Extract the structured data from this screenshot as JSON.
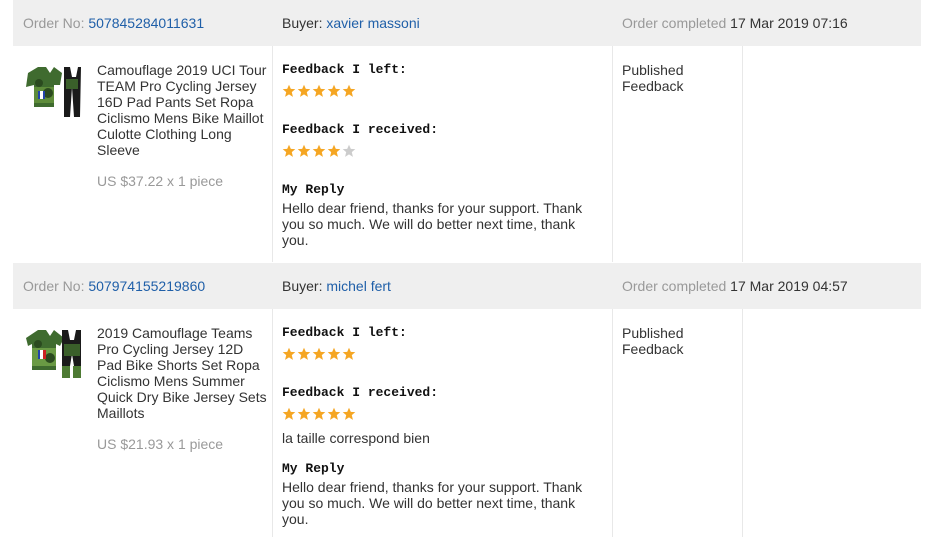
{
  "colors": {
    "header_bg": "#efefef",
    "link": "#1f5fa8",
    "star_on": "#f5a623",
    "star_off": "#cccccc",
    "muted": "#999999"
  },
  "orders": [
    {
      "order_no_label": "Order No:",
      "order_no": "507845284011631",
      "buyer_label": "Buyer:",
      "buyer": "xavier massoni",
      "completed_label": "Order completed",
      "completed_date": "17 Mar 2019 07:16",
      "product_title": "Camouflage 2019 UCI Tour TEAM Pro Cycling Jersey 16D Pad Pants Set Ropa Ciclismo Mens Bike Maillot Culotte Clothing Long Sleeve",
      "price": "US $37.22 x 1 piece",
      "product_image_icon": "cycling-kit-long-sleeve-image",
      "feedback_left_label": "Feedback I left:",
      "feedback_left_stars": 5,
      "feedback_received_label": "Feedback I received:",
      "feedback_received_stars": 4,
      "feedback_received_comment": "",
      "reply_label": "My Reply",
      "reply_text": "Hello dear friend, thanks for your support. Thank you so much. We will do better next time, thank you.",
      "status": "Published Feedback"
    },
    {
      "order_no_label": "Order No:",
      "order_no": "507974155219860",
      "buyer_label": "Buyer:",
      "buyer": "michel fert",
      "completed_label": "Order completed",
      "completed_date": "17 Mar 2019 04:57",
      "product_title": "2019 Camouflage Teams Pro Cycling Jersey 12D Pad Bike Shorts Set Ropa Ciclismo Mens Summer Quick Dry Bike Jersey Sets Maillots",
      "price": "US $21.93 x 1 piece",
      "product_image_icon": "cycling-kit-short-sleeve-image",
      "feedback_left_label": "Feedback I left:",
      "feedback_left_stars": 5,
      "feedback_received_label": "Feedback I received:",
      "feedback_received_stars": 5,
      "feedback_received_comment": "la taille correspond bien",
      "reply_label": "My Reply",
      "reply_text": "Hello dear friend, thanks for your support. Thank you so much. We will do better next time, thank you.",
      "status": "Published Feedback"
    }
  ]
}
